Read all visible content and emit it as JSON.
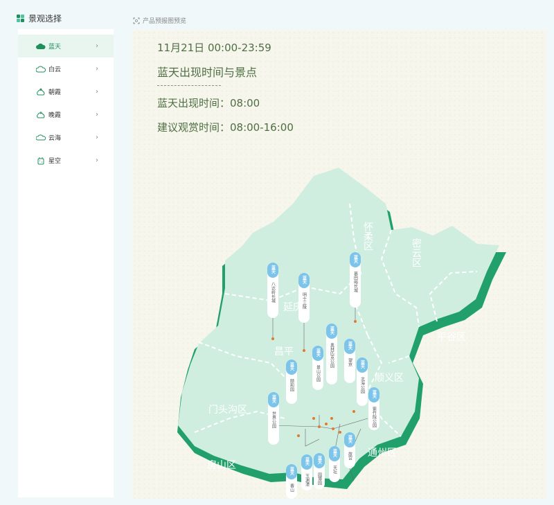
{
  "header": {
    "title": "景观选择"
  },
  "sidebar": {
    "items": [
      {
        "label": "蓝天",
        "icon": "cloud-filled-icon",
        "active": true
      },
      {
        "label": "白云",
        "icon": "cloud-icon",
        "active": false
      },
      {
        "label": "朝霞",
        "icon": "sunrise-icon",
        "active": false
      },
      {
        "label": "晚霞",
        "icon": "sunset-icon",
        "active": false
      },
      {
        "label": "云海",
        "icon": "cloud-sea-icon",
        "active": false
      },
      {
        "label": "星空",
        "icon": "starry-sky-icon",
        "active": false
      }
    ]
  },
  "preview": {
    "label": "产品预报图预览",
    "date_range": "11月21日 00:00-23:59",
    "heading": "蓝天出现时间与景点",
    "appear_time": "蓝天出现时间：08:00",
    "suggest_time": "建议观赏时间：08:00-16:00"
  },
  "map": {
    "districts": [
      "怀柔区",
      "密云区",
      "平谷区",
      "延庆",
      "昌平",
      "顺义区",
      "门头沟区",
      "房山区",
      "通州区"
    ],
    "tag_title": "蓝天",
    "spots": [
      "八达岭长城",
      "明十三陵",
      "慕田峪长城",
      "奥林匹克公园",
      "望京",
      "北海公园",
      "颐和园",
      "景山公园",
      "紫竹院公园",
      "故宫",
      "天坛",
      "园博园",
      "世界公园",
      "玉渊潭",
      "香山"
    ]
  },
  "colors": {
    "accent": "#1f8f5c",
    "map_fill": "#cfeee0",
    "map_edge": "#22a06b",
    "tag_blue": "#7cc4ea"
  }
}
